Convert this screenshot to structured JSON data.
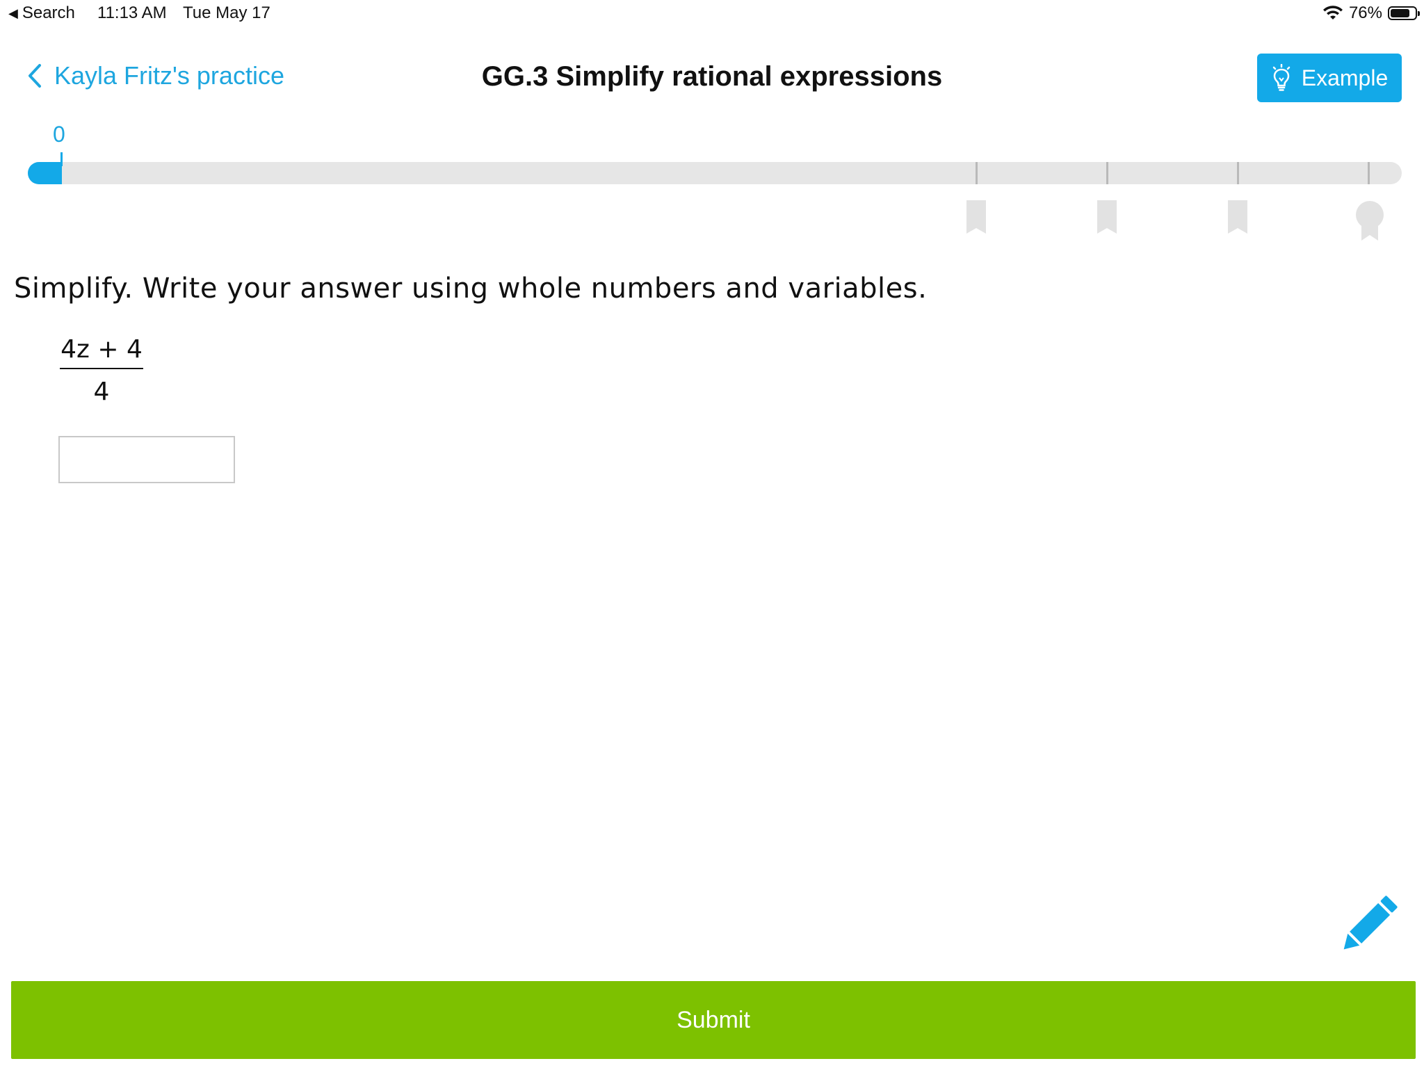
{
  "status_bar": {
    "back_app": "Search",
    "time": "11:13 AM",
    "date": "Tue May 17",
    "battery": "76%"
  },
  "header": {
    "back_label": "Kayla Fritz's practice",
    "title": "GG.3 Simplify rational expressions",
    "example_label": "Example"
  },
  "progress": {
    "score": "0",
    "fill_fraction": 0.025
  },
  "question": {
    "prompt": "Simplify. Write your answer using whole numbers and variables.",
    "numerator": "4z + 4",
    "denominator": "4",
    "answer_value": ""
  },
  "actions": {
    "submit_label": "Submit"
  },
  "colors": {
    "accent": "#13a9e8",
    "link": "#1ea6df",
    "submit": "#7dc100",
    "track": "#e6e6e6"
  }
}
